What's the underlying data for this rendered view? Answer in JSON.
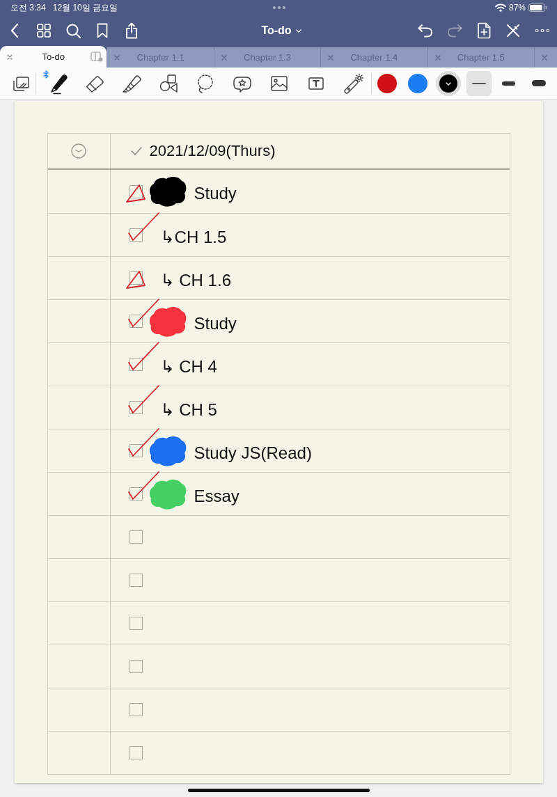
{
  "status_bar": {
    "time": "오전 3:34",
    "date": "12월 10일 금요일",
    "battery": "87%"
  },
  "nav_bar": {
    "title": "To-do",
    "undo": {
      "disabled": false
    },
    "redo": {
      "disabled": true
    }
  },
  "tabs": [
    {
      "kind": "full",
      "label": "To-do",
      "selected": true
    },
    {
      "kind": "full",
      "label": "Chapter 1.1",
      "selected": false
    },
    {
      "kind": "full",
      "label": "Chapter 1.3",
      "selected": false
    },
    {
      "kind": "full",
      "label": "Chapter 1.4",
      "selected": false
    },
    {
      "kind": "full",
      "label": "Chapter 1.5",
      "selected": false
    },
    {
      "kind": "cut",
      "selected": false
    }
  ],
  "toolbar": {
    "tools": [
      {
        "kind": "pen",
        "selected": true,
        "bluetooth": true
      },
      {
        "kind": "eraser",
        "selected": false,
        "bluetooth": false
      },
      {
        "kind": "highlighter",
        "selected": false,
        "bluetooth": false
      },
      {
        "kind": "shapes",
        "selected": false,
        "bluetooth": false
      },
      {
        "kind": "lasso",
        "selected": false,
        "bluetooth": false
      },
      {
        "kind": "sticker",
        "selected": false,
        "bluetooth": false
      },
      {
        "kind": "image",
        "selected": false,
        "bluetooth": false
      },
      {
        "kind": "text",
        "selected": false,
        "bluetooth": false
      },
      {
        "kind": "laser",
        "selected": false,
        "bluetooth": false
      }
    ],
    "colors": [
      {
        "color": "#d10f16",
        "selected": false
      },
      {
        "color": "#1b7cf3",
        "selected": false
      },
      {
        "color": "#000000",
        "selected": true
      }
    ],
    "stroke_widths": [
      {
        "kind": "thin",
        "selected": true
      },
      {
        "kind": "medium",
        "selected": false
      },
      {
        "kind": "thick",
        "selected": false
      }
    ]
  },
  "todo_table": {
    "header": {
      "date": "2021/12/09(Thurs)"
    },
    "rows": [
      {
        "kind": "triangle",
        "color": "#000000",
        "text": "Study"
      },
      {
        "kind": "check",
        "text": "↳CH 1.5"
      },
      {
        "kind": "triangle",
        "text": "↳ CH 1.6"
      },
      {
        "kind": "check",
        "color": "#f4333f",
        "text": "Study"
      },
      {
        "kind": "check",
        "text": "↳ CH 4"
      },
      {
        "kind": "check",
        "text": "↳ CH 5"
      },
      {
        "kind": "check",
        "color": "#1c6ff0",
        "text": "Study JS(Read)"
      },
      {
        "kind": "check",
        "color": "#46d063",
        "text": "Essay"
      },
      {},
      {},
      {},
      {},
      {},
      {}
    ]
  }
}
